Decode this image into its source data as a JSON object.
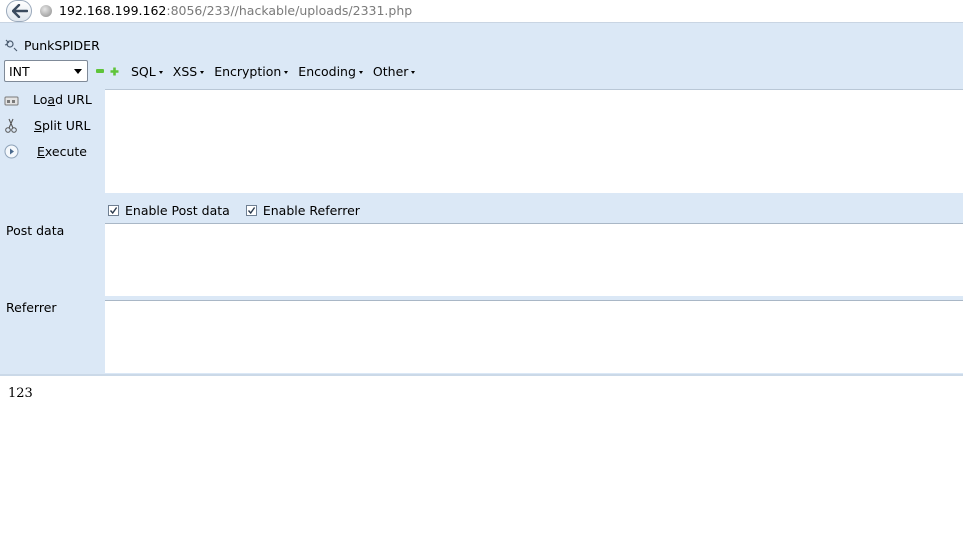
{
  "address_bar": {
    "url_host": "192.168.199.162",
    "url_rest": ":8056/233//hackable/uploads/2331.php"
  },
  "hackbar": {
    "title": "PunkSPIDER",
    "select_value": "INT",
    "menus": [
      "SQL",
      "XSS",
      "Encryption",
      "Encoding",
      "Other"
    ],
    "load_url": {
      "pre": "Lo",
      "key": "a",
      "post": "d URL"
    },
    "split_url": {
      "pre": "",
      "key": "S",
      "post": "plit URL"
    },
    "execute": {
      "pre": "",
      "key": "E",
      "post": "xecute"
    },
    "enable_post": "Enable Post data",
    "enable_referrer": "Enable Referrer",
    "post_label": "Post data",
    "referrer_label": "Referrer",
    "url_value": "",
    "post_value": "",
    "referrer_value": "",
    "enable_post_checked": true,
    "enable_referrer_checked": true
  },
  "page": {
    "output": "123"
  },
  "colors": {
    "panel_bg": "#dbe8f6",
    "accent_green": "#5fc43a"
  }
}
